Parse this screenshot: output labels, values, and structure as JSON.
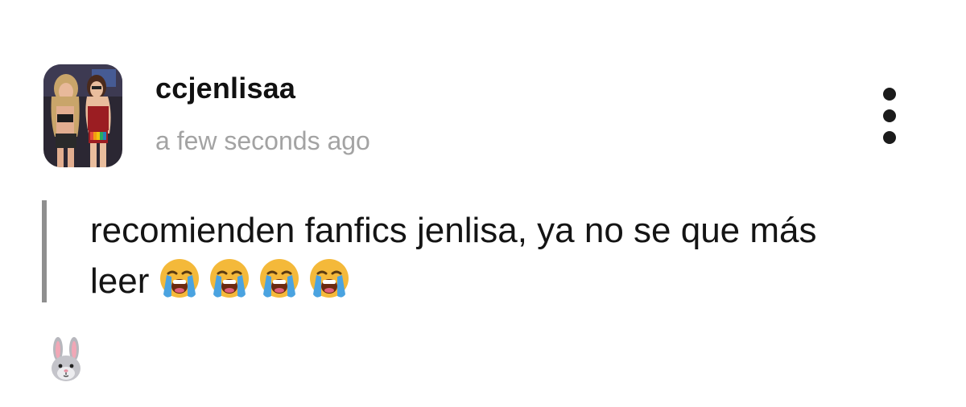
{
  "post": {
    "username": "ccjenlisaa",
    "timestamp": "a few seconds ago",
    "text_line1": "recomienden fanfics jenlisa, ya no se que más",
    "text_line2": "leer",
    "emojis": [
      "loudly-crying-face",
      "loudly-crying-face",
      "loudly-crying-face",
      "loudly-crying-face"
    ]
  },
  "reaction": {
    "icon": "rabbit-face-icon"
  },
  "colors": {
    "text": "#141414",
    "muted": "#a3a3a3",
    "quote_bar": "#8f8f8f",
    "emoji_face": "#f4b93a",
    "emoji_tears": "#4aa3e0"
  }
}
